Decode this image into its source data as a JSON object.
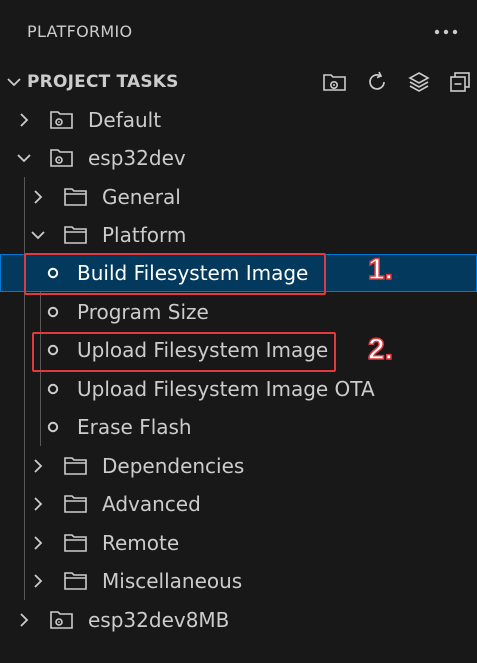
{
  "panel": {
    "title": "PLATFORMIO",
    "more_icon": "ellipsis-icon"
  },
  "section": {
    "title": "PROJECT TASKS",
    "expanded": true,
    "toolbar": [
      {
        "name": "new-terminal-button",
        "icon": "folder-terminal-icon"
      },
      {
        "name": "refresh-button",
        "icon": "refresh-icon"
      },
      {
        "name": "toggle-layers-button",
        "icon": "layers-icon"
      },
      {
        "name": "collapse-all-button",
        "icon": "collapse-all-icon"
      }
    ]
  },
  "tree": {
    "items": [
      {
        "label": "Default",
        "type": "env",
        "expanded": false
      },
      {
        "label": "esp32dev",
        "type": "env",
        "expanded": true
      },
      {
        "label": "General",
        "type": "folder",
        "expanded": false
      },
      {
        "label": "Platform",
        "type": "folder",
        "expanded": true
      },
      {
        "label": "Build Filesystem Image",
        "type": "task",
        "selected": true
      },
      {
        "label": "Program Size",
        "type": "task"
      },
      {
        "label": "Upload Filesystem Image",
        "type": "task"
      },
      {
        "label": "Upload Filesystem Image OTA",
        "type": "task"
      },
      {
        "label": "Erase Flash",
        "type": "task"
      },
      {
        "label": "Dependencies",
        "type": "folder",
        "expanded": false
      },
      {
        "label": "Advanced",
        "type": "folder",
        "expanded": false
      },
      {
        "label": "Remote",
        "type": "folder",
        "expanded": false
      },
      {
        "label": "Miscellaneous",
        "type": "folder",
        "expanded": false
      },
      {
        "label": "esp32dev8MB",
        "type": "env",
        "expanded": false
      }
    ]
  },
  "annotations": [
    {
      "label": "1.",
      "target": "Build Filesystem Image",
      "color": "#e0393e"
    },
    {
      "label": "2.",
      "target": "Upload Filesystem Image",
      "color": "#e0393e"
    }
  ],
  "colors": {
    "background": "#181818",
    "selection": "#04395e",
    "selection_border": "#0078d4",
    "annotation": "#e0393e"
  }
}
